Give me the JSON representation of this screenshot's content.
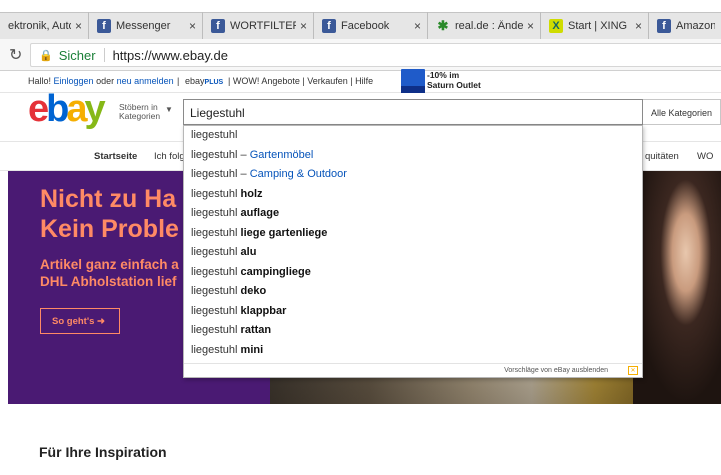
{
  "browser": {
    "tabs": [
      {
        "title": "ektronik, Auto",
        "favicon": "none",
        "active": false
      },
      {
        "title": "Messenger",
        "favicon": "facebook",
        "active": false
      },
      {
        "title": "WORTFILTER.DE",
        "favicon": "facebook",
        "active": false
      },
      {
        "title": "Facebook",
        "favicon": "facebook",
        "active": false
      },
      {
        "title": "real.de : Änder",
        "favicon": "real",
        "active": false
      },
      {
        "title": "Start | XING",
        "favicon": "xing",
        "active": false
      },
      {
        "title": "Amazon",
        "favicon": "facebook",
        "active": false
      }
    ],
    "tab_close": "×",
    "security_label": "Sicher",
    "url": "https://www.ebay.de"
  },
  "ebay_topbar": {
    "greeting": "Hallo!",
    "login": "Einloggen",
    "or": "oder",
    "register": "neu anmelden",
    "ebayplus_eb": "ebay",
    "ebayplus_plus": "PLUS",
    "links": "| WOW! Angebote | Verkaufen | Hilfe",
    "promo_line1": "-10% im",
    "promo_line2": "Saturn Outlet"
  },
  "header": {
    "logo": [
      "e",
      "b",
      "a",
      "y"
    ],
    "browse_line1": "Stöbern in",
    "browse_line2": "Kategorien",
    "search_value": "Liegestuhl",
    "category_select": "Alle Kategorien"
  },
  "nav": {
    "home": "Startseite",
    "following": "Ich folge",
    "right_partial": "quitäten",
    "right_partial2": "WO"
  },
  "suggestions": {
    "items": [
      {
        "base": "liegestuhl",
        "bold": "",
        "category": ""
      },
      {
        "base": "liegestuhl – ",
        "bold": "",
        "category": "Gartenmöbel"
      },
      {
        "base": "liegestuhl – ",
        "bold": "",
        "category": "Camping & Outdoor"
      },
      {
        "base": "liegestuhl ",
        "bold": "holz",
        "category": ""
      },
      {
        "base": "liegestuhl ",
        "bold": "auflage",
        "category": ""
      },
      {
        "base": "liegestuhl ",
        "bold": "liege gartenliege",
        "category": ""
      },
      {
        "base": "liegestuhl ",
        "bold": "alu",
        "category": ""
      },
      {
        "base": "liegestuhl ",
        "bold": "campingliege",
        "category": ""
      },
      {
        "base": "liegestuhl ",
        "bold": "deko",
        "category": ""
      },
      {
        "base": "liegestuhl ",
        "bold": "klappbar",
        "category": ""
      },
      {
        "base": "liegestuhl ",
        "bold": "rattan",
        "category": ""
      },
      {
        "base": "liegestuhl ",
        "bold": "mini",
        "category": ""
      }
    ],
    "footer_text": "Vorschläge von eBay ausblenden"
  },
  "hero": {
    "headline_line1": "Nicht zu Ha",
    "headline_line2": "Kein Proble",
    "sub_line1": "Artikel ganz einfach a",
    "sub_line2": "DHL Abholstation lief",
    "cta": "So geht's ➜"
  },
  "inspiration": {
    "title": "Für Ihre Inspiration"
  },
  "colors": {
    "hero_bg": "#4a1a73",
    "hero_text": "#ff8a65",
    "link": "#0654ba",
    "secure": "#1a7f37"
  }
}
